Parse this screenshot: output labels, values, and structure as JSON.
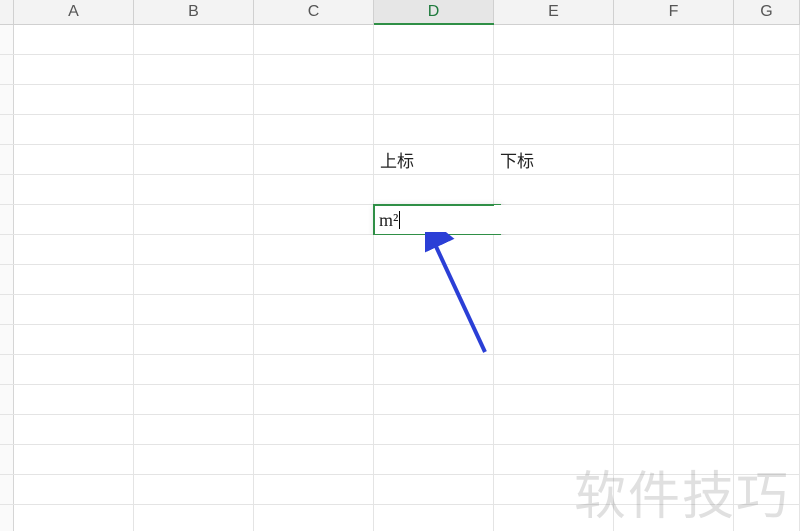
{
  "columns": [
    "A",
    "B",
    "C",
    "D",
    "E",
    "F",
    "G"
  ],
  "active_column_index": 3,
  "row_count": 17,
  "cells": {
    "D5": "上标",
    "E5": "下标"
  },
  "editing_cell": {
    "ref": "D7",
    "value": "m²"
  },
  "watermark": "软件技巧",
  "chart_data": null
}
